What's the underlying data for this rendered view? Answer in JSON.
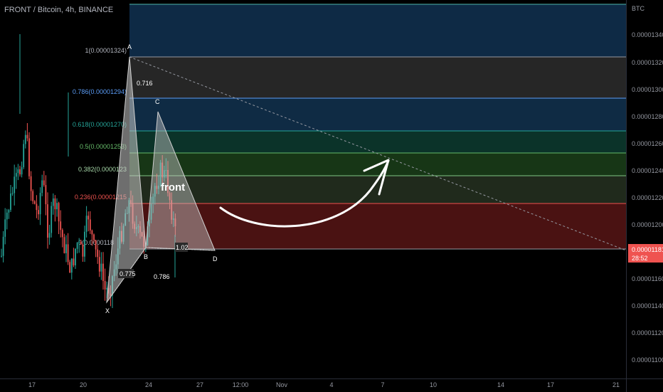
{
  "symbol": {
    "title": "FRONT / Bitcoin, 4h, BINANCE"
  },
  "price_axis": {
    "unit": "BTC",
    "labels": [
      "0.00001340",
      "0.00001320",
      "0.00001300",
      "0.00001280",
      "0.00001260",
      "0.00001240",
      "0.00001220",
      "0.00001200",
      "0.00001160",
      "0.00001140",
      "0.00001120",
      "0.00001100"
    ]
  },
  "time_axis": {
    "labels": [
      "17",
      "20",
      "24",
      "27",
      "12:00",
      "Nov",
      "4",
      "7",
      "10",
      "14",
      "17",
      "21"
    ]
  },
  "current_price": {
    "price": "0.00001181",
    "countdown": "28:52"
  },
  "fib_levels": [
    {
      "label": "1(0.00001324)"
    },
    {
      "label": "0.786(0.00001294)"
    },
    {
      "label": "0.618(0.00001270)"
    },
    {
      "label": "0.5(0.00001253)"
    },
    {
      "label": "0.382(0.0000123"
    },
    {
      "label": "0.236(0.00001215"
    },
    {
      "label": "0(0.0000118"
    }
  ],
  "pattern": {
    "points": {
      "x": "X",
      "a": "A",
      "b": "B",
      "c": "C",
      "d": "D"
    },
    "ratios": {
      "xa_b": "0.716",
      "xb": "0.775",
      "bc": "0.786",
      "cd": "1.02"
    }
  },
  "annotation": {
    "text": "front"
  },
  "colors": {
    "up": "#26a69a",
    "down": "#ef5350"
  }
}
